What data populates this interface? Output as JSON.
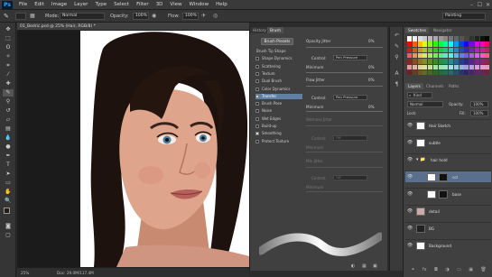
{
  "app": {
    "logo": "Ps"
  },
  "menu": [
    "File",
    "Edit",
    "Image",
    "Layer",
    "Type",
    "Select",
    "Filter",
    "3D",
    "View",
    "Window",
    "Help"
  ],
  "window_controls": [
    "–",
    "☐",
    "✕"
  ],
  "options": {
    "mode_label": "Mode:",
    "mode_value": "Normal",
    "opacity_label": "Opacity:",
    "opacity_value": "100%",
    "flow_label": "Flow:",
    "flow_value": "100%",
    "workspace": "Painting"
  },
  "document": {
    "tab_title": "01_Bedric.psd @ 25% (Hair, RGB/8) *",
    "zoom": "25%",
    "doc_info": "Doc: 29.0M/117.4M"
  },
  "brush_panel": {
    "tabs": [
      "History",
      "Brush"
    ],
    "presets_button": "Brush Presets",
    "options": [
      {
        "label": "Brush Tip Shape",
        "checked": false,
        "heading": true
      },
      {
        "label": "Shape Dynamics",
        "checked": false
      },
      {
        "label": "Scattering",
        "checked": false
      },
      {
        "label": "Texture",
        "checked": false
      },
      {
        "label": "Dual Brush",
        "checked": false
      },
      {
        "label": "Color Dynamics",
        "checked": false
      },
      {
        "label": "Transfer",
        "checked": true,
        "selected": true
      },
      {
        "label": "Brush Pose",
        "checked": false
      },
      {
        "label": "Noise",
        "checked": false
      },
      {
        "label": "Wet Edges",
        "checked": false
      },
      {
        "label": "Build-up",
        "checked": false
      },
      {
        "label": "Smoothing",
        "checked": true
      },
      {
        "label": "Protect Texture",
        "checked": false
      }
    ],
    "opacity_jitter_label": "Opacity Jitter",
    "opacity_jitter_value": "0%",
    "control_label": "Control:",
    "control_value": "Pen Pressure",
    "minimum_label": "Minimum",
    "flow_jitter_label": "Flow Jitter",
    "flow_jitter_value": "0%",
    "control2_value": "Pen Pressure",
    "wetness_jitter_label": "Wetness Jitter",
    "control3_value": "Off",
    "minimum3_label": "Minimum",
    "mix_jitter_label": "Mix Jitter",
    "control4_value": "Off",
    "minimum4_label": "Minimum",
    "min_value": "0%"
  },
  "swatches": {
    "tabs": [
      "Swatches",
      "Navigator"
    ]
  },
  "layers": {
    "tabs": [
      "Layers",
      "Channels",
      "Paths"
    ],
    "kind_label": "Kind",
    "blend_value": "Normal",
    "opacity_label": "Opacity:",
    "opacity_value": "100%",
    "lock_label": "Lock:",
    "fill_label": "Fill:",
    "fill_value": "100%",
    "items": [
      {
        "name": "Hair Sketch",
        "selected": false
      },
      {
        "name": "subtle",
        "selected": false
      },
      {
        "name": "hair hold",
        "selected": false,
        "group": true
      },
      {
        "name": "col",
        "selected": true
      },
      {
        "name": "base",
        "selected": false
      },
      {
        "name": "detail",
        "selected": false
      },
      {
        "name": "BG",
        "selected": false
      },
      {
        "name": "Background",
        "selected": false
      }
    ]
  },
  "colors": {
    "accent": "#5f7fa4",
    "panel": "#404040",
    "toolbar": "#353535",
    "layer_selected": "#5a6f8d"
  }
}
